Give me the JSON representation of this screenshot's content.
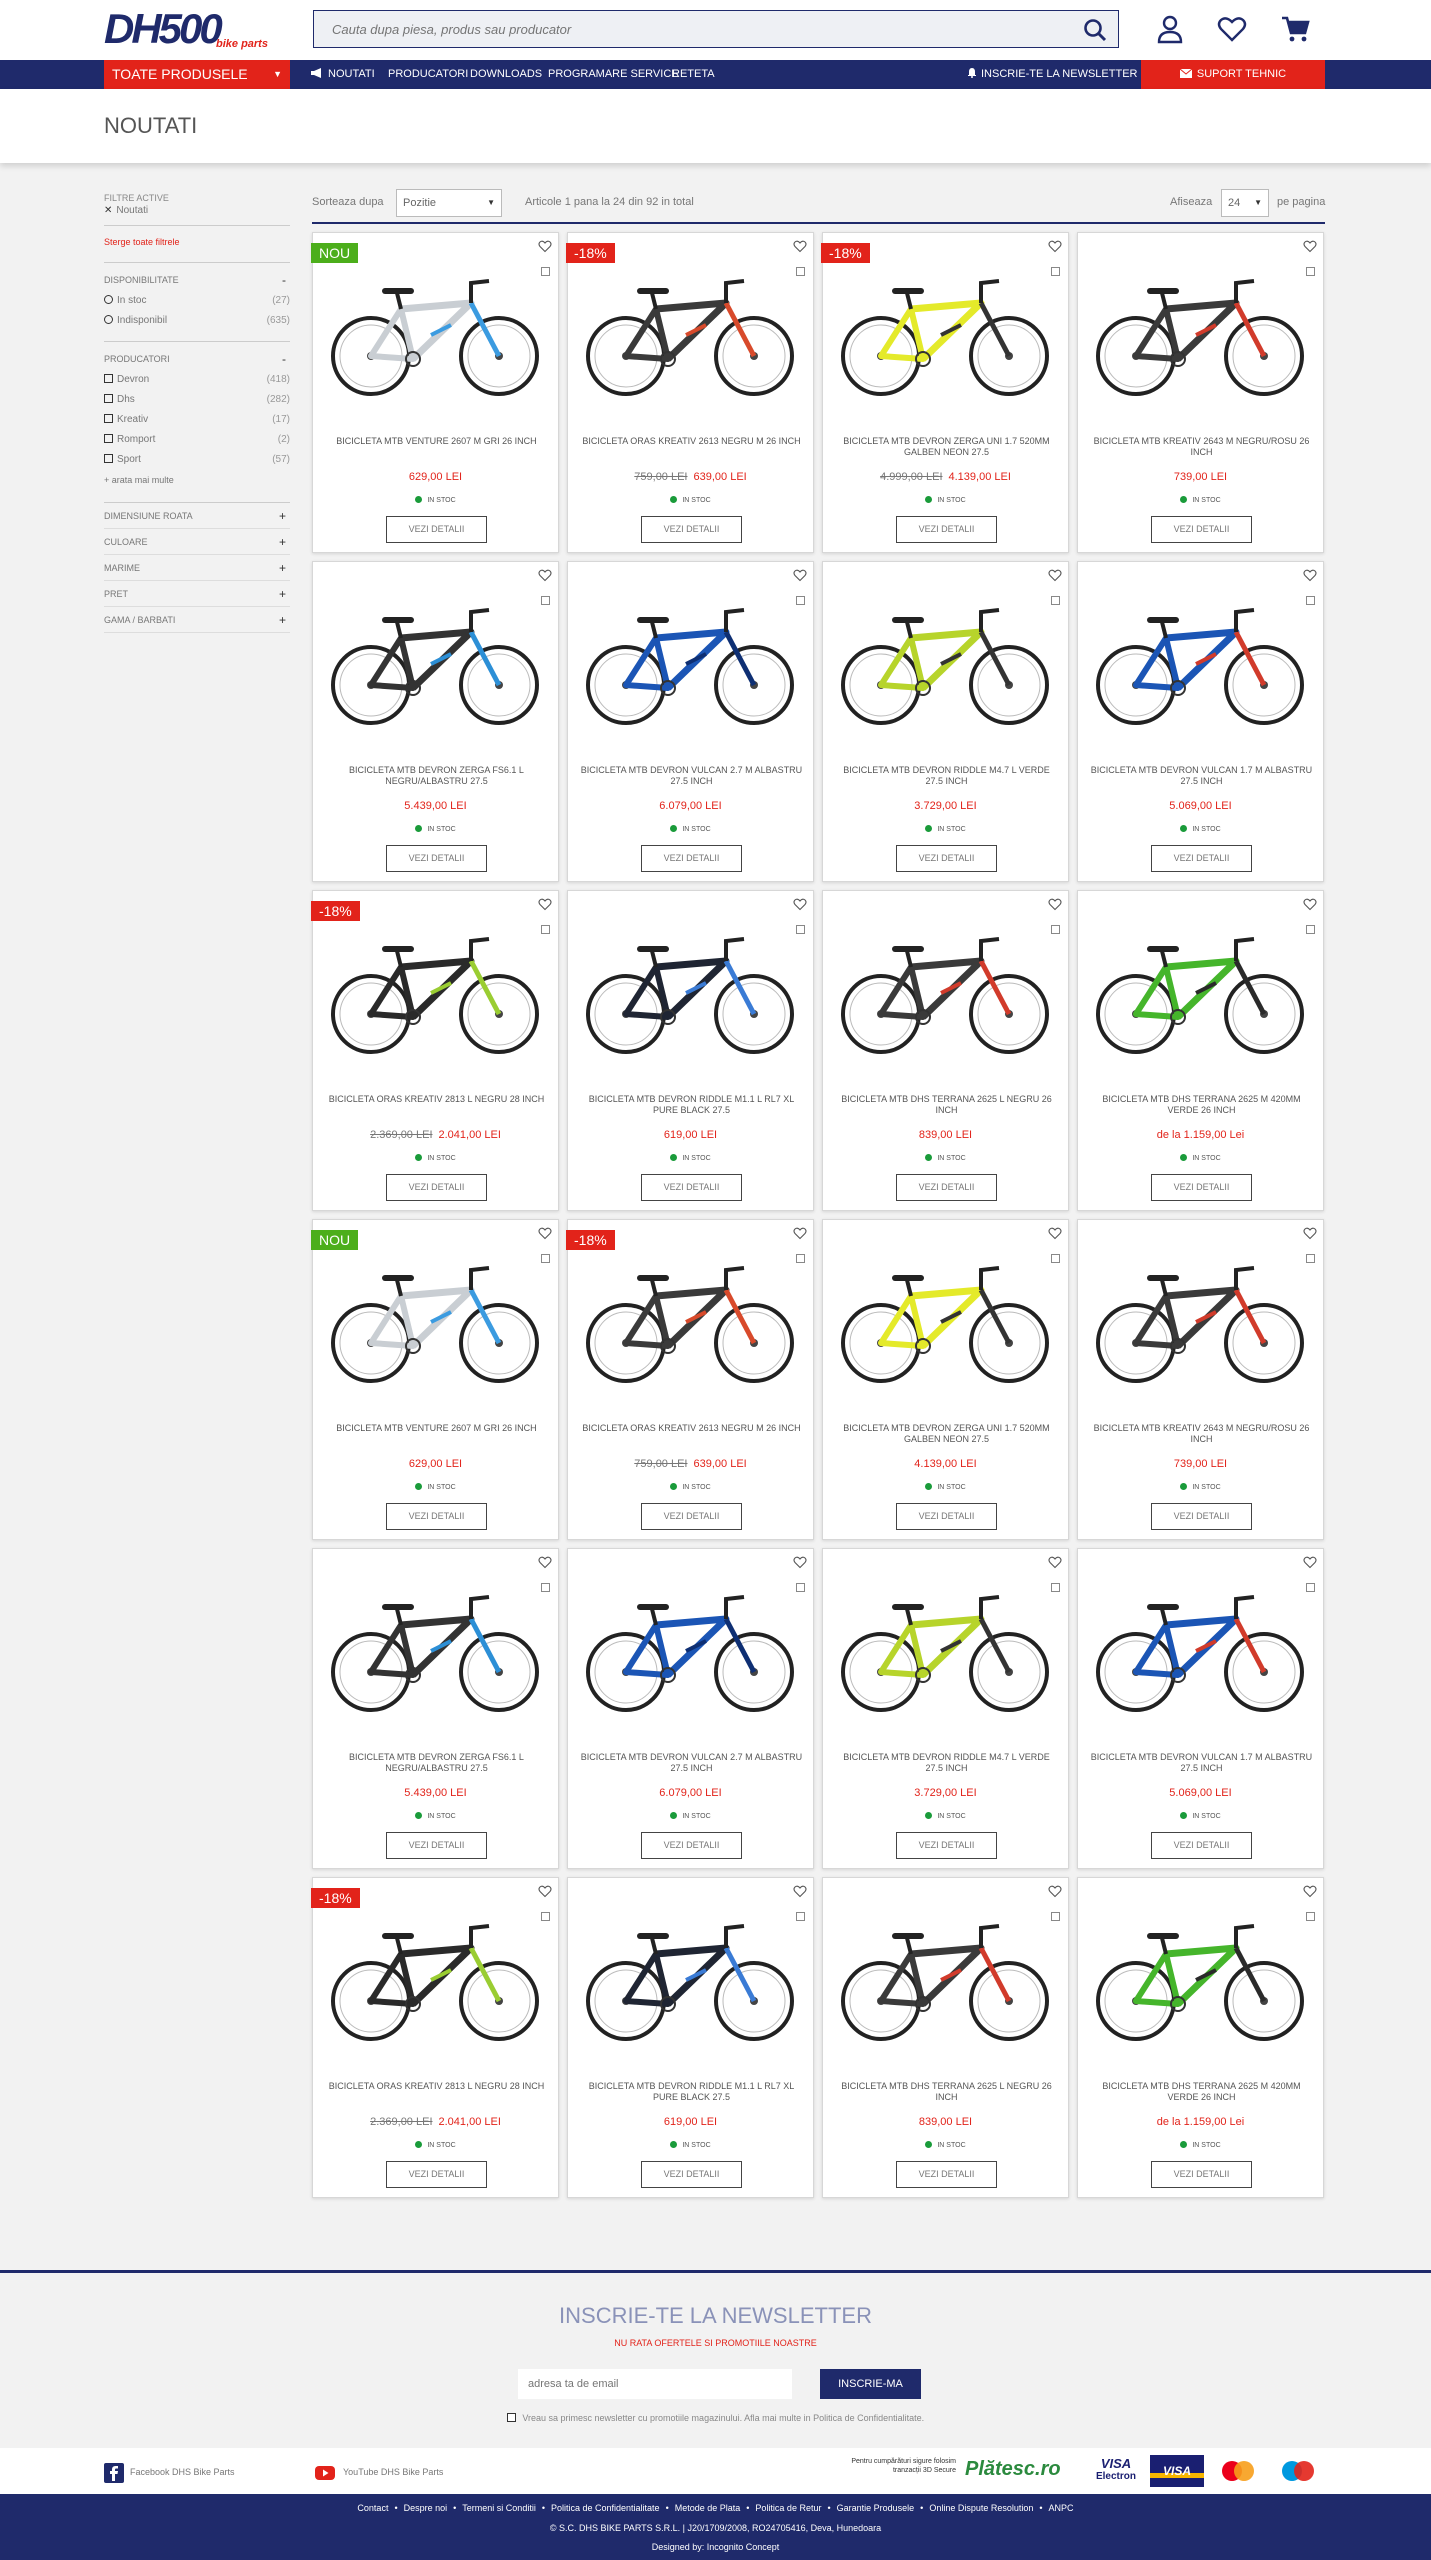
{
  "header": {
    "logo_text": "DH500",
    "logo_tagline": "bike parts",
    "search_placeholder": "Cauta dupa piesa, produs sau producator"
  },
  "nav": {
    "all_products": "Toate produsele",
    "links": [
      "Noutati",
      "Producatori",
      "Downloads",
      "Programare service",
      "Reteta"
    ],
    "newsletter": "Inscrie-te la newsletter",
    "support": "Suport tehnic"
  },
  "page": {
    "title": "NOUTATI"
  },
  "sidebar": {
    "active_filter_label": "Filtre active",
    "active_filter": "Noutati",
    "clear_filters": "Sterge toate filtrele",
    "availability_label": "Disponibilitate",
    "availability": [
      {
        "label": "In stoc",
        "count": "(27)"
      },
      {
        "label": "Indisponibil",
        "count": "(635)"
      }
    ],
    "producers_label": "Producatori",
    "producers": [
      {
        "label": "Devron",
        "count": "(418)"
      },
      {
        "label": "Dhs",
        "count": "(282)"
      },
      {
        "label": "Kreativ",
        "count": "(17)"
      },
      {
        "label": "Romport",
        "count": "(2)"
      },
      {
        "label": "Sport",
        "count": "(57)"
      }
    ],
    "show_more": "+ arata mai multe",
    "collapsed": [
      "Dimensiune roata",
      "Culoare",
      "Marime",
      "Pret",
      "Gama / Barbati"
    ]
  },
  "toolbar": {
    "sort_label": "Sorteaza dupa",
    "sort_value": "Pozitie",
    "count_text": "Articole 1 pana la 24 din 92 in total",
    "show_label": "Afiseaza",
    "per_page_value": "24",
    "per_page_suffix": "pe pagina"
  },
  "products": [
    {
      "name": "BICICLETA MTB VENTURE 2607 M GRI 26 INCH",
      "old_price": "",
      "price": "629,00 LEI",
      "badge": "NOU",
      "frame": "#c9ced3",
      "accent": "#3b9be0"
    },
    {
      "name": "BICICLETA ORAS KREATIV 2613 NEGRU M 26 INCH",
      "old_price": "759,00 LEI",
      "price": "639,00 LEI",
      "badge": "-18%",
      "frame": "#3a3a3a",
      "accent": "#d84a2b"
    },
    {
      "name": "BICICLETA MTB DEVRON ZERGA UNI 1.7 520MM GALBEN NEON 27.5",
      "old_price": "4.999,00 LEI",
      "price": "4.139,00 LEI",
      "badge": "-18%",
      "frame": "#e4ea2a",
      "accent": "#333333"
    },
    {
      "name": "BICICLETA MTB KREATIV 2643 M NEGRU/ROSU 26 INCH",
      "old_price": "",
      "price": "739,00 LEI",
      "badge": "",
      "frame": "#3a3a3a",
      "accent": "#d13b2b"
    },
    {
      "name": "BICICLETA MTB DEVRON ZERGA FS6.1 L NEGRU/ALBASTRU 27.5",
      "old_price": "",
      "price": "5.439,00 LEI",
      "badge": "",
      "frame": "#333333",
      "accent": "#2c8fd6"
    },
    {
      "name": "BICICLETA MTB DEVRON VULCAN 2.7 M ALBASTRU 27.5 INCH",
      "old_price": "",
      "price": "6.079,00 LEI",
      "badge": "",
      "frame": "#1b55b5",
      "accent": "#0e2f73"
    },
    {
      "name": "BICICLETA MTB DEVRON RIDDLE M4.7 L VERDE 27.5 INCH",
      "old_price": "",
      "price": "3.729,00 LEI",
      "badge": "",
      "frame": "#b7d42b",
      "accent": "#333333"
    },
    {
      "name": "BICICLETA MTB DEVRON VULCAN 1.7 M ALBASTRU 27.5 INCH",
      "old_price": "",
      "price": "5.069,00 LEI",
      "badge": "",
      "frame": "#1b55b5",
      "accent": "#d13b2b"
    },
    {
      "name": "BICICLETA ORAS KREATIV 2813 L NEGRU 28 INCH",
      "old_price": "2.369,00 LEI",
      "price": "2.041,00 LEI",
      "badge": "-18%",
      "frame": "#2a2a2a",
      "accent": "#9acd32"
    },
    {
      "name": "BICICLETA MTB DEVRON RIDDLE M1.1 L RL7 XL PURE BLACK 27.5",
      "old_price": "",
      "price": "619,00 LEI",
      "badge": "",
      "frame": "#1f2533",
      "accent": "#3a7bd5"
    },
    {
      "name": "BICICLETA MTB DHS TERRANA 2625 L NEGRU 26 INCH",
      "old_price": "",
      "price": "839,00 LEI",
      "badge": "",
      "frame": "#3a3a3a",
      "accent": "#d13b2b"
    },
    {
      "name": "BICICLETA MTB DHS TERRANA 2625 M 420MM VERDE 26 INCH",
      "old_price": "",
      "price": "de la 1.159,00 Lei",
      "badge": "",
      "frame": "#45b52b",
      "accent": "#2a2a2a"
    },
    {
      "name": "BICICLETA MTB VENTURE 2607 M GRI 26 INCH",
      "old_price": "",
      "price": "629,00 LEI",
      "badge": "NOU",
      "frame": "#c9ced3",
      "accent": "#3b9be0"
    },
    {
      "name": "BICICLETA ORAS KREATIV 2613 NEGRU M 26 INCH",
      "old_price": "759,00 LEI",
      "price": "639,00 LEI",
      "badge": "-18%",
      "frame": "#3a3a3a",
      "accent": "#d84a2b"
    },
    {
      "name": "BICICLETA MTB DEVRON ZERGA UNI 1.7 520MM GALBEN NEON 27.5",
      "old_price": "",
      "price": "4.139,00 LEI",
      "badge": "",
      "frame": "#e4ea2a",
      "accent": "#333333"
    },
    {
      "name": "BICICLETA MTB KREATIV 2643 M NEGRU/ROSU 26 INCH",
      "old_price": "",
      "price": "739,00 LEI",
      "badge": "",
      "frame": "#3a3a3a",
      "accent": "#d13b2b"
    },
    {
      "name": "BICICLETA MTB DEVRON ZERGA FS6.1 L NEGRU/ALBASTRU 27.5",
      "old_price": "",
      "price": "5.439,00 LEI",
      "badge": "",
      "frame": "#333333",
      "accent": "#2c8fd6"
    },
    {
      "name": "BICICLETA MTB DEVRON VULCAN 2.7 M ALBASTRU 27.5 INCH",
      "old_price": "",
      "price": "6.079,00 LEI",
      "badge": "",
      "frame": "#1b55b5",
      "accent": "#0e2f73"
    },
    {
      "name": "BICICLETA MTB DEVRON RIDDLE M4.7 L VERDE 27.5 INCH",
      "old_price": "",
      "price": "3.729,00 LEI",
      "badge": "",
      "frame": "#b7d42b",
      "accent": "#333333"
    },
    {
      "name": "BICICLETA MTB DEVRON VULCAN 1.7 M ALBASTRU 27.5 INCH",
      "old_price": "",
      "price": "5.069,00 LEI",
      "badge": "",
      "frame": "#1b55b5",
      "accent": "#d13b2b"
    },
    {
      "name": "BICICLETA ORAS KREATIV 2813 L NEGRU 28 INCH",
      "old_price": "2.369,00 LEI",
      "price": "2.041,00 LEI",
      "badge": "-18%",
      "frame": "#2a2a2a",
      "accent": "#9acd32"
    },
    {
      "name": "BICICLETA MTB DEVRON RIDDLE M1.1 L RL7 XL PURE BLACK 27.5",
      "old_price": "",
      "price": "619,00 LEI",
      "badge": "",
      "frame": "#1f2533",
      "accent": "#3a7bd5"
    },
    {
      "name": "BICICLETA MTB DHS TERRANA 2625 L NEGRU 26 INCH",
      "old_price": "",
      "price": "839,00 LEI",
      "badge": "",
      "frame": "#3a3a3a",
      "accent": "#d13b2b"
    },
    {
      "name": "BICICLETA MTB DHS TERRANA 2625 M 420MM VERDE 26 INCH",
      "old_price": "",
      "price": "de la 1.159,00 Lei",
      "badge": "",
      "frame": "#45b52b",
      "accent": "#2a2a2a"
    }
  ],
  "product_common": {
    "stock_label": "In stoc",
    "details_button": "Vezi detalii",
    "badge_colors": {
      "NOU": "#4cae1b",
      "-18%": "#e2231a"
    }
  },
  "newsletter": {
    "title": "INSCRIE-TE LA NEWSLETTER",
    "subtitle": "Nu rata ofertele si promotiile noastre",
    "email_placeholder": "adresa ta de email",
    "button": "Inscrie-ma",
    "consent": "Vreau sa primesc newsletter cu promotiile magazinului. Afla mai multe in Politica de Confidentialitate."
  },
  "social": {
    "facebook": "Facebook DHS Bike Parts",
    "youtube": "YouTube DHS Bike Parts",
    "platitor_text": "Pentru cumpărături sigure folosim tranzacții 3D Secure",
    "platitor_logo": "Plătesc.ro",
    "visa_electron_1": "VISA",
    "visa_electron_2": "Electron",
    "visa": "VISA"
  },
  "footer": {
    "links": [
      "Contact",
      "Despre noi",
      "Termeni si Conditii",
      "Politica de Confidentialitate",
      "Metode de Plata",
      "Politica de Retur",
      "Garantie Produsele",
      "Online Dispute Resolution",
      "ANPC"
    ],
    "copyright": "© S.C. DHS BIKE PARTS S.R.L.  |  J20/1709/2008, RO24705416, Deva, Hunedoara",
    "designed": "Designed by: Incognito Concept"
  },
  "colors": {
    "primary": "#1f2a6b",
    "accent": "#e2231a",
    "stock": "#1a9b3a"
  }
}
